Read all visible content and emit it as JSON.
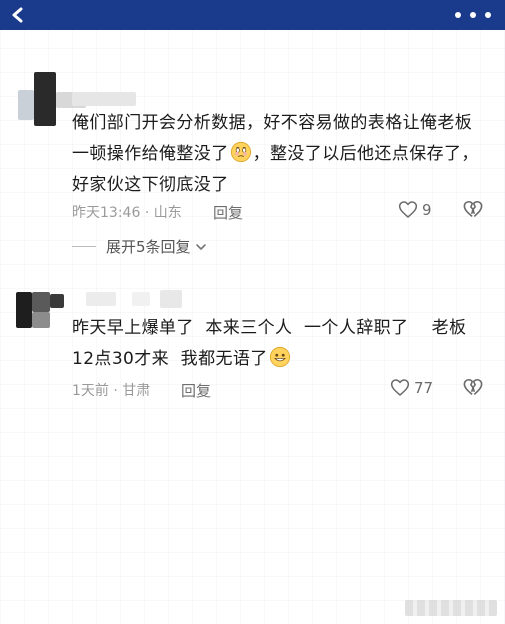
{
  "header": {
    "back_icon": "chevron-left-icon",
    "more_icon": "more-horizontal-icon",
    "bg_color": "#1a3a8c"
  },
  "comments": [
    {
      "text_before_emoji": "俺们部门开会分析数据，好不容易做的表格让俺老板一顿操作给俺整没了",
      "emoji": "crying-face-icon",
      "text_after_emoji": "，整没了以后他还点保存了，好家伙这下彻底没了",
      "time": "昨天13:46",
      "location": "山东",
      "reply_label": "回复",
      "likes": "9",
      "expand_label": "展开5条回复"
    },
    {
      "text_before_emoji": "昨天早上爆单了  本来三个人  一个人辞职了    老板12点30才来  我都无语了",
      "emoji": "grinning-face-icon",
      "text_after_emoji": "",
      "time": "1天前",
      "location": "甘肃",
      "reply_label": "回复",
      "likes": "77"
    }
  ]
}
